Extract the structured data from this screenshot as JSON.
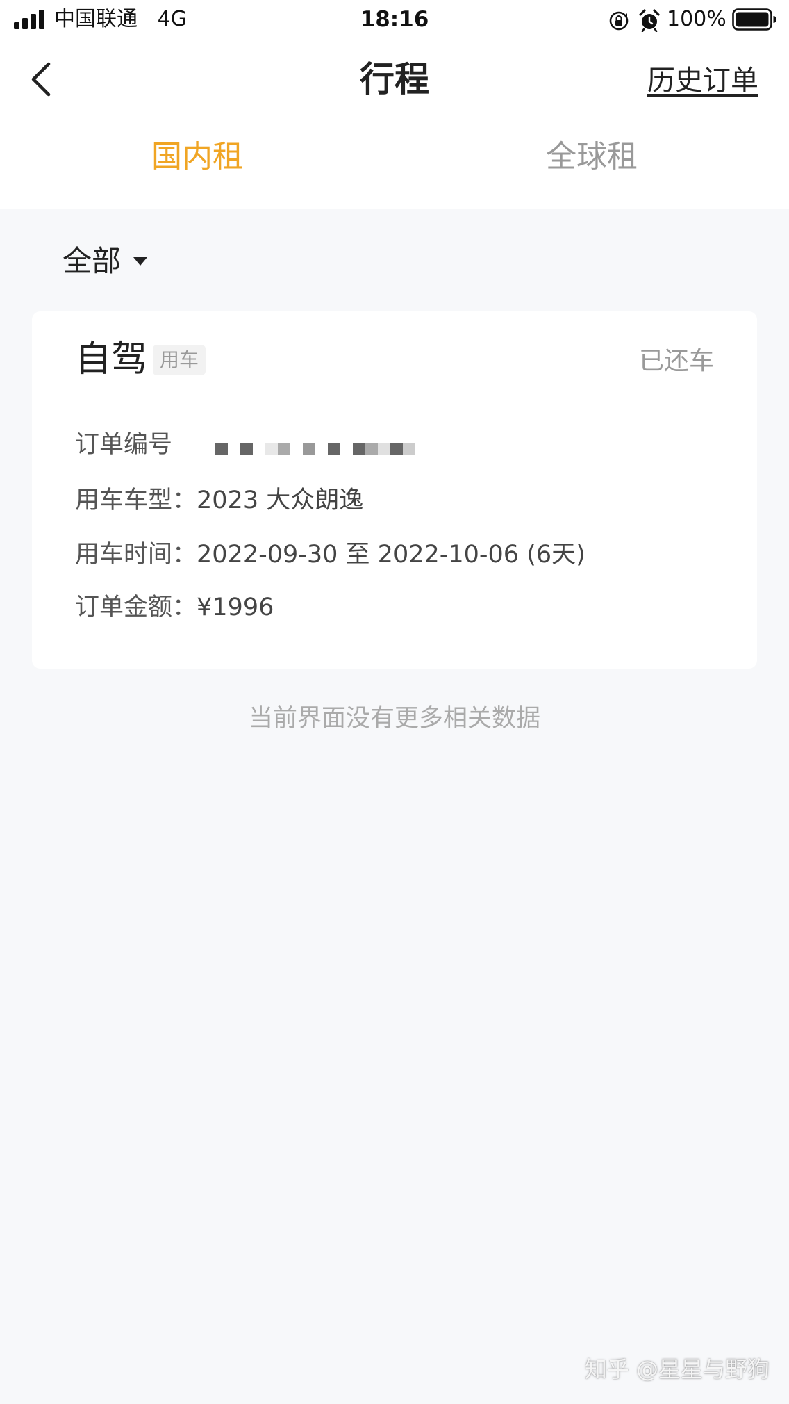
{
  "status_bar": {
    "carrier": "中国联通",
    "network": "4G",
    "time": "18:16",
    "battery": "100%"
  },
  "nav": {
    "title": "行程",
    "history_link": "历史订单"
  },
  "tabs": [
    {
      "label": "国内租",
      "active": true
    },
    {
      "label": "全球租",
      "active": false
    }
  ],
  "filter": {
    "label": "全部"
  },
  "order": {
    "title": "自驾",
    "tag": "用车",
    "status": "已还车",
    "order_no_label": "订单编号",
    "model_label": "用车车型：",
    "model_value": "2023 大众朗逸",
    "time_label": "用车时间：",
    "time_value": "2022-09-30 至 2022-10-06 (6天)",
    "amount_label": "订单金额：",
    "amount_value": "¥1996"
  },
  "end_text": "当前界面没有更多相关数据",
  "watermark": "知乎 @星星与野狗",
  "colors": {
    "accent": "#f0a524",
    "inactive_tab": "#999999",
    "background": "#f7f8fa",
    "card": "#ffffff"
  }
}
